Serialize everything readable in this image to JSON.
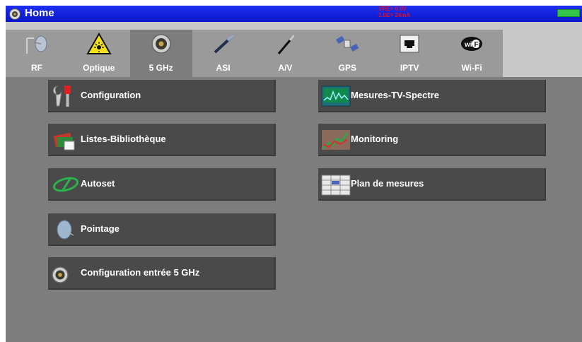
{
  "titlebar": {
    "title": "Home",
    "status_line1": "VRE= 0.0V",
    "status_line2": "1.0E= 24mA",
    "accent_color": "#0d1fd8",
    "status_color": "#e0102a"
  },
  "tabs": [
    {
      "label": "RF",
      "icon": "satellite-antenna-icon"
    },
    {
      "label": "Optique",
      "icon": "laser-warning-icon"
    },
    {
      "label": "5 GHz",
      "icon": "n-connector-icon",
      "active": true
    },
    {
      "label": "ASI",
      "icon": "asi-cable-icon"
    },
    {
      "label": "A/V",
      "icon": "av-cable-icon"
    },
    {
      "label": "GPS",
      "icon": "gps-satellite-icon"
    },
    {
      "label": "IPTV",
      "icon": "ethernet-port-icon"
    },
    {
      "label": "Wi-Fi",
      "icon": "wifi-logo-icon"
    }
  ],
  "menu_left": [
    {
      "label": "Configuration",
      "icon": "tools-icon"
    },
    {
      "label": "Listes-Bibliothèque",
      "icon": "library-icon"
    },
    {
      "label": "Autoset",
      "icon": "autoset-icon"
    },
    {
      "label": "Pointage",
      "icon": "dish-icon"
    },
    {
      "label": "Configuration entrée 5 GHz",
      "icon": "n-connector-icon"
    }
  ],
  "menu_right": [
    {
      "label": "Mesures-TV-Spectre",
      "icon": "spectrum-icon"
    },
    {
      "label": "Monitoring",
      "icon": "monitoring-graph-icon"
    },
    {
      "label": "Plan de mesures",
      "icon": "measurement-plan-icon"
    }
  ]
}
